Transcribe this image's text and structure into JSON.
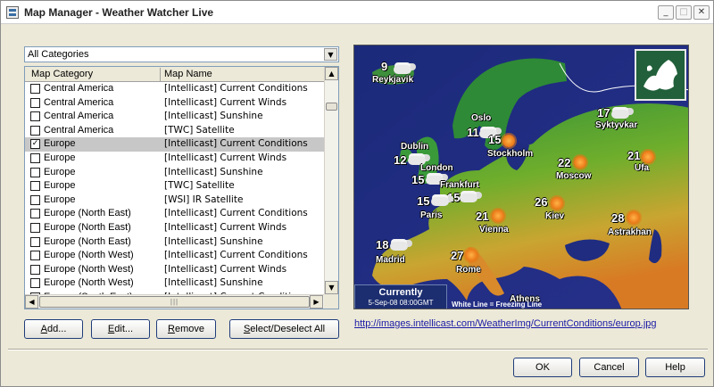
{
  "window": {
    "title": "Map Manager - Weather Watcher Live"
  },
  "title_buttons": {
    "minimize": "_",
    "maximize": "□",
    "close": "✕"
  },
  "category_select": {
    "value": "All Categories"
  },
  "list": {
    "columns": [
      "Map Category",
      "Map Name"
    ],
    "rows": [
      {
        "category": "Central America",
        "name": "[Intellicast] Current Conditions",
        "checked": false,
        "selected": false
      },
      {
        "category": "Central America",
        "name": "[Intellicast] Current Winds",
        "checked": false,
        "selected": false
      },
      {
        "category": "Central America",
        "name": "[Intellicast] Sunshine",
        "checked": false,
        "selected": false
      },
      {
        "category": "Central America",
        "name": "[TWC] Satellite",
        "checked": false,
        "selected": false
      },
      {
        "category": "Europe",
        "name": "[Intellicast] Current Conditions",
        "checked": true,
        "selected": true
      },
      {
        "category": "Europe",
        "name": "[Intellicast] Current Winds",
        "checked": false,
        "selected": false
      },
      {
        "category": "Europe",
        "name": "[Intellicast] Sunshine",
        "checked": false,
        "selected": false
      },
      {
        "category": "Europe",
        "name": "[TWC] Satellite",
        "checked": false,
        "selected": false
      },
      {
        "category": "Europe",
        "name": "[WSI] IR Satellite",
        "checked": false,
        "selected": false
      },
      {
        "category": "Europe (North East)",
        "name": "[Intellicast] Current Conditions",
        "checked": false,
        "selected": false
      },
      {
        "category": "Europe (North East)",
        "name": "[Intellicast] Current Winds",
        "checked": false,
        "selected": false
      },
      {
        "category": "Europe (North East)",
        "name": "[Intellicast] Sunshine",
        "checked": false,
        "selected": false
      },
      {
        "category": "Europe (North West)",
        "name": "[Intellicast] Current Conditions",
        "checked": false,
        "selected": false
      },
      {
        "category": "Europe (North West)",
        "name": "[Intellicast] Current Winds",
        "checked": false,
        "selected": false
      },
      {
        "category": "Europe (North West)",
        "name": "[Intellicast] Sunshine",
        "checked": false,
        "selected": false
      },
      {
        "category": "Europe (South East)",
        "name": "[Intellicast] Current Conditions",
        "checked": false,
        "selected": false
      }
    ]
  },
  "buttons": {
    "add": {
      "hotkey": "A",
      "rest": "dd..."
    },
    "edit": {
      "hotkey": "E",
      "rest": "dit..."
    },
    "remove": {
      "hotkey": "R",
      "rest": "emove"
    },
    "select_all": {
      "hotkey": "S",
      "rest": "elect/Deselect All"
    },
    "ok": "OK",
    "cancel": "Cancel",
    "help": "Help"
  },
  "map": {
    "url": "http://images.intellicast.com/WeatherImg/CurrentConditions/europ.jpg",
    "current_label": "Currently",
    "current_datetime": "5-Sep-08 08:00GMT",
    "freezing_note": "White Line = Freezing Line",
    "cities": [
      {
        "name": "Reykjavik",
        "temp": "9",
        "icon": "cloud-sun-icon"
      },
      {
        "name": "Oslo",
        "temp": "11",
        "icon": "cloud-icon"
      },
      {
        "name": "Stockholm",
        "temp": "15",
        "icon": "sun-icon"
      },
      {
        "name": "Syktyvkar",
        "temp": "17",
        "icon": "cloud-icon"
      },
      {
        "name": "Dublin",
        "temp": "12",
        "icon": "cloud-icon"
      },
      {
        "name": "London",
        "temp": "15",
        "icon": "cloud-icon"
      },
      {
        "name": "Frankfurt",
        "temp": "15",
        "icon": "cloud-icon"
      },
      {
        "name": "Paris",
        "temp": "15",
        "icon": "cloud-icon"
      },
      {
        "name": "Moscow",
        "temp": "22",
        "icon": "sun-icon"
      },
      {
        "name": "Ufa",
        "temp": "21",
        "icon": "sun-icon"
      },
      {
        "name": "Kiev",
        "temp": "26",
        "icon": "sun-icon"
      },
      {
        "name": "Vienna",
        "temp": "21",
        "icon": "sun-icon"
      },
      {
        "name": "Astrakhan",
        "temp": "28",
        "icon": "sun-icon"
      },
      {
        "name": "Madrid",
        "temp": "18",
        "icon": "cloud-sun-icon"
      },
      {
        "name": "Rome",
        "temp": "27",
        "icon": "sun-icon"
      },
      {
        "name": "Athens",
        "temp": "",
        "icon": ""
      }
    ]
  },
  "colors": {
    "accent_link": "#1a1aa6",
    "dialog_bg": "#ece9d8",
    "selected_row": "#c7c7c7"
  }
}
